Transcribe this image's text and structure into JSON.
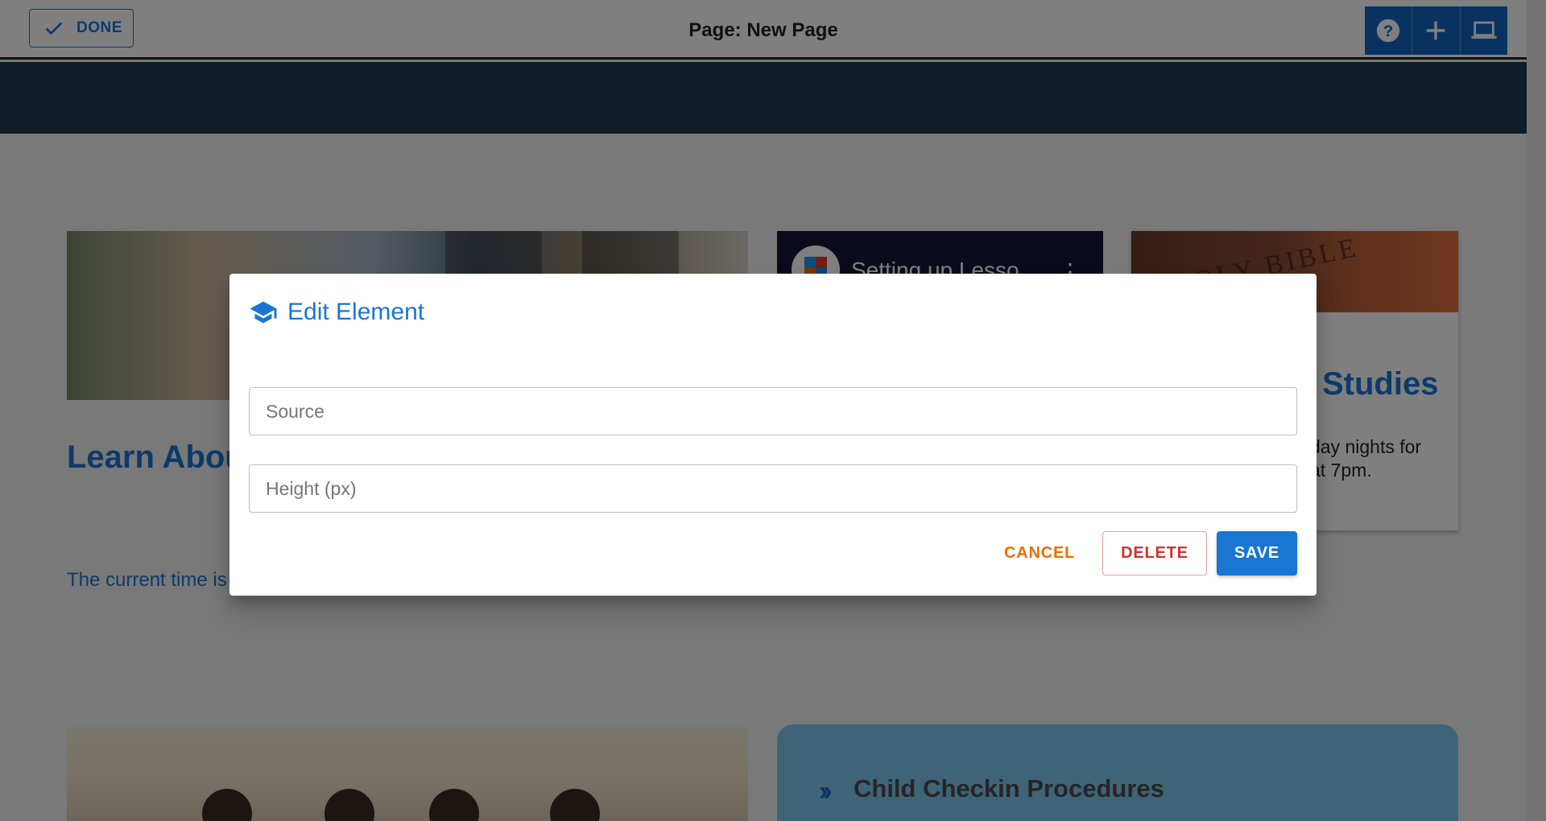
{
  "toolbar": {
    "done_label": "DONE",
    "page_title": "Page: New Page",
    "tools": [
      {
        "icon": "help-icon"
      },
      {
        "icon": "plus-icon"
      },
      {
        "icon": "laptop-icon"
      }
    ]
  },
  "background": {
    "learn_heading": "Learn About",
    "time_text": "The current time is",
    "video_title": "Setting up Lesso",
    "bible_photo_text": "HOLY BIBLE",
    "bible_heading": "Studies",
    "bible_desc_line1": "day nights for",
    "bible_desc_line2": "at 7pm.",
    "checkin_title": "Child Checkin Procedures"
  },
  "dialog": {
    "title": "Edit Element",
    "icon": "graduation-cap-icon",
    "source_placeholder": "Source",
    "height_placeholder": "Height (px)",
    "cancel_label": "CANCEL",
    "delete_label": "DELETE",
    "save_label": "SAVE"
  },
  "colors": {
    "primary": "#1976d2",
    "cancel": "#ef6c00",
    "delete": "#d32f2f",
    "nav_band": "#1e3a4c"
  }
}
